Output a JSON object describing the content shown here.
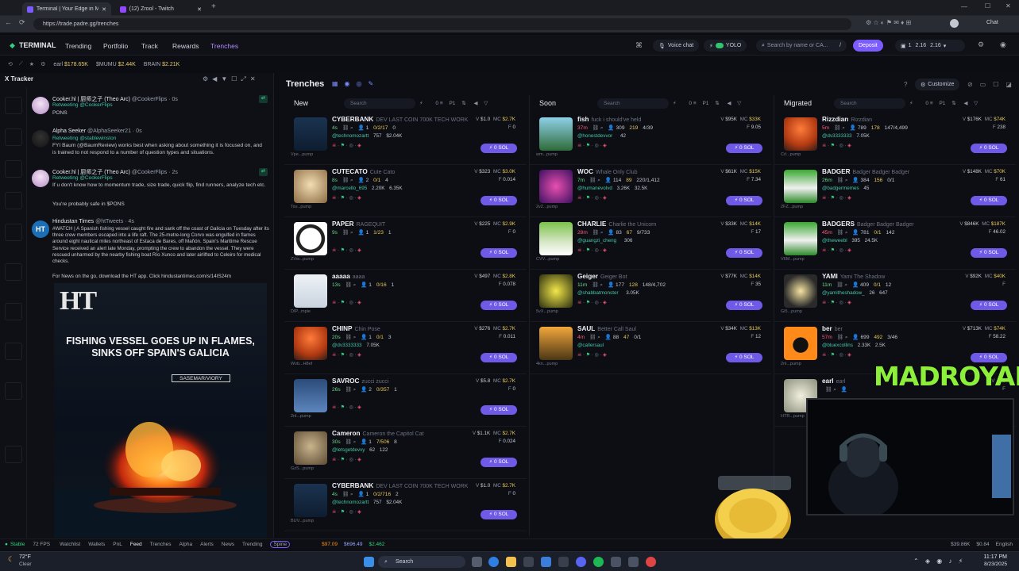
{
  "browser": {
    "tabs": [
      {
        "title": "Terminal | Your Edge in Meme"
      },
      {
        "title": "(12) Zrool - Twitch"
      }
    ],
    "url": "https://trade.padre.gg/trenches",
    "chat_label": "Chat"
  },
  "appnav": {
    "logo": "TERMINAL",
    "links": [
      "Trending",
      "Portfolio",
      "Track",
      "Rewards",
      "Trenches"
    ],
    "active": "Trenches",
    "voice_chat": "Voice chat",
    "yolo": "YOLO",
    "search_placeholder": "Search by name or CA...",
    "search_key": "/",
    "deposit": "Deposit",
    "wallet_count": "1",
    "balance_a": "2.16",
    "balance_b": "2.16"
  },
  "ticker": [
    {
      "name": "earl",
      "value": "$178.65K"
    },
    {
      "name": "$MUMU",
      "value": "$2.44K"
    },
    {
      "name": "BRAIN",
      "value": "$2.21K"
    }
  ],
  "tracker": {
    "title": "X Tracker",
    "tweets": [
      {
        "name": "Cooker.hl | 厨师之子 (Theo Arc)",
        "handle": "@CookerFlips · 0s",
        "sub": "Retweeting @CookerFlips",
        "body": "PONS"
      },
      {
        "name": "Alpha Seeker",
        "handle": "@AlphaSeeker21 · 0s",
        "sub": "Retweeting @stablewinston",
        "body": "FYI Baum (@BaumReview) works best when asking about something it is focused on, and is trained to not respond to a number of question types and situations."
      },
      {
        "name": "Cooker.hl | 厨师之子 (Theo Arc)",
        "handle": "@CookerFlips · 2s",
        "sub": "Retweeting @CookerFlips",
        "body": "If u don't know how to momentum trade, size trade, quick flip, find runners, analyze tech etc.",
        "body2": "You're probably safe in $PONS"
      },
      {
        "name": "Hindustan Times",
        "handle": "@htTweets · 4s",
        "body": "#WATCH | A Spanish fishing vessel caught fire and sank off the coast of Galicia on Tuesday after its three crew members escaped into a life raft. The 25-metre-long Corvo was engulfed in flames around eight nautical miles northeast of Estaca de Bares, off Mañón. Spain's Maritime Rescue Service received an alert late Monday, prompting the crew to abandon the vessel. They were rescued unharmed by the nearby fishing boat Río Xunco and later airlifted to Celeiro for medical checks.",
        "body2": "For News on the go, download the HT app. Click hindustantimes.com/s/14IS24m"
      }
    ],
    "media": {
      "logo": "HT",
      "headline": "FISHING VESSEL GOES UP IN FLAMES, SINKS OFF SPAIN'S GALICIA",
      "credit": "SASEMAR/VIORY"
    }
  },
  "trenches": {
    "title": "Trenches",
    "customize": "Customize",
    "columns": [
      {
        "title": "New",
        "search": "Search",
        "counter": "0",
        "preset": "P1",
        "tokens": [
          {
            "ticker": "CYBERBANK",
            "name": "DEV LAST COIN 700K TECH WORK",
            "age": "4s",
            "holders": "1",
            "tx": "0/2/17",
            "stat": "0",
            "creator": "@technomozartt",
            "followers": "757",
            "mc": "$2.04K",
            "v": "$1.0",
            "mcap": "$2.7K",
            "f": "0",
            "tag": "Vpe...pump",
            "avatar": "bank"
          },
          {
            "ticker": "CUTECATO",
            "name": "Cute Cato",
            "age": "8s",
            "holders": "2",
            "tx": "0/1",
            "stat": "4",
            "creator": "@marcello_695",
            "followers": "2.20K",
            "mc": "6.35K",
            "v": "$323",
            "mcap": "$3.0K",
            "f": "0.014",
            "tag": "Tsv...pump",
            "avatar": "cat"
          },
          {
            "ticker": "PAPER",
            "name": "RAGEQUIT",
            "age": "9s",
            "holders": "1",
            "tx": "1/23",
            "stat": "1",
            "creator": "",
            "followers": "",
            "mc": "",
            "v": "$225",
            "mcap": "$2.9K",
            "f": "0",
            "tag": "ZVw...pump",
            "avatar": "badge"
          },
          {
            "ticker": "aaaaa",
            "name": "aaaa",
            "age": "13s",
            "holders": "1",
            "tx": "0/16",
            "stat": "1",
            "creator": "",
            "followers": "",
            "mc": "",
            "v": "$497",
            "mcap": "$2.8K",
            "f": "0.078",
            "tag": "DIP...mpie",
            "avatar": "white"
          },
          {
            "ticker": "CHINP",
            "name": "Chin Pose",
            "age": "20s",
            "holders": "1",
            "tx": "0/1",
            "stat": "3",
            "creator": "@dv3333333",
            "followers": "7.05K",
            "mc": "",
            "v": "$276",
            "mcap": "$2.7K",
            "f": "0.011",
            "tag": "Wvb...H8ef",
            "avatar": "ginger"
          },
          {
            "ticker": "SAVROC",
            "name": "zucci zucci",
            "age": "26s",
            "holders": "2",
            "tx": "0/357",
            "stat": "1",
            "creator": "",
            "followers": "",
            "mc": "",
            "v": "$5.8",
            "mcap": "$2.7K",
            "f": "0",
            "tag": "2nl...pump",
            "avatar": "man"
          },
          {
            "ticker": "Cameron",
            "name": "Cameron the Capitol Cat",
            "age": "30s",
            "holders": "1",
            "tx": "7/506",
            "stat": "8",
            "creator": "@letsgetdevvy",
            "followers": "62",
            "mc": "122",
            "v": "$1.1K",
            "mcap": "$2.7K",
            "f": "0.024",
            "tag": "GzS...pump",
            "avatar": "tabby"
          },
          {
            "ticker": "CYBERBANK",
            "name": "DEV LAST COIN 700K TECH WORK",
            "age": "4s",
            "holders": "1",
            "tx": "0/2/716",
            "stat": "2",
            "creator": "@technomozartt",
            "followers": "757",
            "mc": "$2.04K",
            "v": "$1.0",
            "mcap": "$2.7K",
            "f": "0",
            "tag": "BUV...pump",
            "avatar": "bank"
          }
        ]
      },
      {
        "title": "Soon",
        "search": "Search",
        "counter": "0",
        "preset": "P1",
        "tokens": [
          {
            "ticker": "fish",
            "name": "fuck i should've held",
            "age": "37m",
            "holders": "309",
            "tx": "219",
            "stat": "4/39",
            "creator": "@honestdevvor",
            "followers": "",
            "mc": "42",
            "v": "$95K",
            "mcap": "$33K",
            "f": "9.05",
            "tag": "wm...pump",
            "avatar": "fish"
          },
          {
            "ticker": "WOC",
            "name": "Whale Only Club",
            "age": "7m",
            "holders": "114",
            "tx": "89",
            "stat": "220/1,412",
            "creator": "@humanevolvd",
            "followers": "3.26K",
            "mc": "32.5K",
            "v": "$61K",
            "mcap": "$15K",
            "f": "7.34",
            "tag": "2v2...pump",
            "avatar": "anime"
          },
          {
            "ticker": "CHARLIE",
            "name": "Charlie the Unicorn",
            "age": "28m",
            "holders": "83",
            "tx": "67",
            "stat": "9/733",
            "creator": "@guangzi_cheng",
            "followers": "",
            "mc": "306",
            "v": "$33K",
            "mcap": "$14K",
            "f": "17",
            "tag": "CVV...pump",
            "avatar": "unicorn"
          },
          {
            "ticker": "Geiger",
            "name": "Geiger Bot",
            "age": "11m",
            "holders": "177",
            "tx": "128",
            "stat": "148/4,702",
            "creator": "@shabbatmonster",
            "followers": "",
            "mc": "3.05K",
            "v": "$77K",
            "mcap": "$14K",
            "f": "35",
            "tag": "5vX...pump",
            "avatar": "geiger"
          },
          {
            "ticker": "SAUL",
            "name": "Better Call Saul",
            "age": "4m",
            "holders": "88",
            "tx": "47",
            "stat": "0/1",
            "creator": "@callersaul",
            "followers": "",
            "mc": "",
            "v": "$34K",
            "mcap": "$13K",
            "f": "12",
            "tag": "4kn...pump",
            "avatar": "saul"
          }
        ]
      },
      {
        "title": "Migrated",
        "search": "Search",
        "counter": "0",
        "preset": "P1",
        "tokens": [
          {
            "ticker": "Rizzdian",
            "name": "Rizzdian",
            "age": "5m",
            "holders": "789",
            "tx": "178",
            "stat": "147/4,499",
            "creator": "@dv3333333",
            "followers": "7.05K",
            "mc": "",
            "v": "$176K",
            "mcap": "$74K",
            "f": "238",
            "tag": "Crl...pump",
            "avatar": "ginger"
          },
          {
            "ticker": "BADGER",
            "name": "Badger Badger Badger",
            "age": "26m",
            "holders": "384",
            "tx": "156",
            "stat": "0/1",
            "creator": "@badgermemes",
            "followers": "45",
            "mc": "",
            "v": "$148K",
            "mcap": "$70K",
            "f": "61",
            "tag": "2FZ...pump",
            "avatar": "badger"
          },
          {
            "ticker": "BADGERS",
            "name": "Badger Badger Badger",
            "age": "45m",
            "holders": "781",
            "tx": "0/1",
            "stat": "142",
            "creator": "@theweebl",
            "followers": "395",
            "mc": "24.5K",
            "v": "$846K",
            "mcap": "$187K",
            "f": "46.02",
            "tag": "V6M...pump",
            "avatar": "badger"
          },
          {
            "ticker": "YAMI",
            "name": "Yami The Shadow",
            "age": "11m",
            "holders": "409",
            "tx": "0/1",
            "stat": "12",
            "creator": "@yamitheshadow_",
            "followers": "26",
            "mc": "647",
            "v": "$92K",
            "mcap": "$40K",
            "f": "",
            "tag": "Gi5...pump",
            "avatar": "yami"
          },
          {
            "ticker": "ber",
            "name": "ber",
            "age": "57m",
            "holders": "699",
            "tx": "492",
            "stat": "3/46",
            "creator": "@bluexcollins",
            "followers": "2.33K",
            "mc": "2.5K",
            "v": "$713K",
            "mcap": "$74K",
            "f": "58.22",
            "tag": "2nl...pump",
            "avatar": "ber"
          },
          {
            "ticker": "earl",
            "name": "earl",
            "age": "",
            "holders": "",
            "tx": "",
            "stat": "",
            "creator": "",
            "followers": "",
            "mc": "",
            "v": "",
            "mcap": "",
            "f": "",
            "tag": "HTR...pump",
            "avatar": "earl"
          }
        ]
      }
    ],
    "buy_label": "0 SOL"
  },
  "statusbar": {
    "connection": "Stable",
    "fps": "72 FPS",
    "items": [
      "Watchlist",
      "Wallets",
      "PnL",
      "Feed",
      "Trenches",
      "Alpha",
      "Alerts",
      "News",
      "Trending",
      "Spine"
    ],
    "price_btc": "$97.09",
    "price_eth": "$696.49",
    "price_sol": "$2.462",
    "right_stat_a": "$39.86K",
    "right_stat_b": "$0.84",
    "lang": "English"
  },
  "taskbar": {
    "weather_temp": "72°F",
    "weather_desc": "Clear",
    "search": "Search",
    "time": "11:17 PM",
    "date": "8/23/2025"
  },
  "overlay": {
    "streamer": "MADROYALS"
  }
}
